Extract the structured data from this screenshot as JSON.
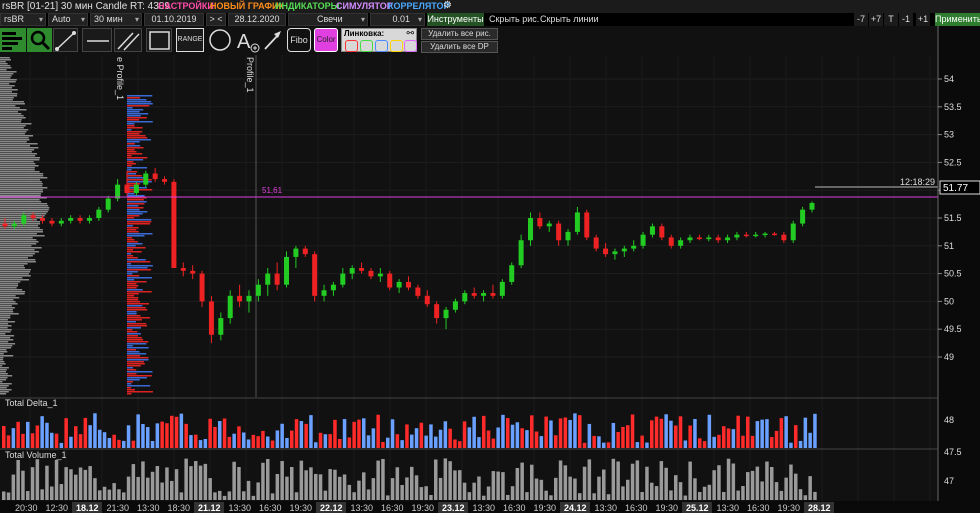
{
  "window": {
    "title": "rsBR [01-21] 30 мин Candle RT: 4309"
  },
  "menu": [
    {
      "label": "НАСТРОЙКИ",
      "color": "#ff4aa8"
    },
    {
      "label": "НОВЫЙ ГРАФИК",
      "color": "#ff8c1a"
    },
    {
      "label": "ИНДИКАТОРЫ",
      "color": "#55dd55"
    },
    {
      "label": "СИМУЛЯТОР",
      "color": "#d48cff"
    },
    {
      "label": "КОРРЕЛЯТОР",
      "color": "#4aa8ff"
    }
  ],
  "controls": {
    "symbol": "rsBR",
    "scale_mode": "Auto",
    "timeframe": "30 мин",
    "date_from": "01.10.2019",
    "nav": "> <",
    "date_to": "28.12.2020",
    "chart_type": "Свечи",
    "step": "0.01",
    "instruments_label": "Инструменты",
    "hide_drawings": "Скрыть рис.",
    "hide_lines": "Скрыть линии",
    "shift_buttons": [
      "-7",
      "+7",
      "T",
      "-1",
      "+1"
    ],
    "apply_label": "Применить"
  },
  "tools": {
    "range_label": "RANGE",
    "fibo_label": "Fibo",
    "color_label": "Color",
    "linking_label": "Линковка:",
    "delete_drawings": "Удалить все рис.",
    "delete_dp": "Удалить все DP",
    "link_colors": [
      "#ff3333",
      "#44dd44",
      "#4a8cff",
      "#ffd700",
      "#e066ff"
    ]
  },
  "chart": {
    "profile_labels": [
      "e Profile_1",
      "Profile_1"
    ],
    "level_line_label": "51,61",
    "current_time": "12:18:29",
    "last_price": "51.77",
    "panels": [
      "Total Delta_1",
      "Total Volume_1"
    ],
    "colors": {
      "up": "#22cc22",
      "down": "#ee2222",
      "level": "#e040e0",
      "delta_pos": "#6aa0ff",
      "delta_neg": "#ff2a2a",
      "volume": "#9a9a9a"
    }
  },
  "price_axis": {
    "ticks": [
      "54",
      "53.5",
      "53",
      "52.5",
      "52",
      "51.5",
      "51",
      "50.5",
      "50",
      "49.5",
      "49"
    ],
    "lower_ticks": [
      "48",
      "47.5",
      "47"
    ]
  },
  "time_axis": {
    "labels": [
      "20:30",
      "12:30",
      "18.12",
      "21:30",
      "13:30",
      "18:30",
      "21.12",
      "13:30",
      "16:30",
      "19:30",
      "22.12",
      "13:30",
      "16:30",
      "19:30",
      "23.12",
      "13:30",
      "16:30",
      "19:30",
      "24.12",
      "13:30",
      "16:30",
      "19:30",
      "25.12",
      "13:30",
      "16:30",
      "19:30",
      "28.12"
    ],
    "date_labels": [
      "18.12",
      "21.12",
      "22.12",
      "23.12",
      "24.12",
      "25.12",
      "28.12"
    ]
  },
  "chart_data": {
    "type": "candlestick",
    "y_range": [
      48.7,
      54.2
    ],
    "level": 51.61,
    "last": 51.77,
    "candles_ohlc": [
      [
        51.4,
        51.5,
        51.3,
        51.35
      ],
      [
        51.35,
        51.45,
        51.3,
        51.4
      ],
      [
        51.4,
        51.6,
        51.35,
        51.55
      ],
      [
        51.55,
        51.6,
        51.45,
        51.5
      ],
      [
        51.5,
        51.55,
        51.4,
        51.45
      ],
      [
        51.45,
        51.5,
        51.35,
        51.4
      ],
      [
        51.4,
        51.5,
        51.35,
        51.45
      ],
      [
        51.45,
        51.55,
        51.4,
        51.5
      ],
      [
        51.5,
        51.55,
        51.4,
        51.45
      ],
      [
        51.45,
        51.55,
        51.4,
        51.5
      ],
      [
        51.5,
        51.7,
        51.45,
        51.65
      ],
      [
        51.65,
        51.9,
        51.6,
        51.85
      ],
      [
        51.85,
        52.2,
        51.8,
        52.1
      ],
      [
        52.1,
        52.35,
        51.9,
        51.95
      ],
      [
        51.95,
        52.15,
        51.9,
        52.1
      ],
      [
        52.1,
        52.35,
        52.05,
        52.3
      ],
      [
        52.3,
        52.4,
        52.15,
        52.2
      ],
      [
        52.2,
        52.25,
        52.1,
        52.15
      ],
      [
        52.15,
        52.2,
        50.6,
        50.6
      ],
      [
        50.6,
        50.7,
        50.45,
        50.55
      ],
      [
        50.55,
        50.65,
        50.4,
        50.5
      ],
      [
        50.5,
        50.55,
        49.9,
        50.0
      ],
      [
        50.0,
        50.1,
        49.25,
        49.4
      ],
      [
        49.4,
        49.8,
        49.3,
        49.7
      ],
      [
        49.7,
        50.2,
        49.6,
        50.1
      ],
      [
        50.1,
        50.3,
        49.9,
        50.0
      ],
      [
        50.0,
        50.2,
        49.8,
        50.1
      ],
      [
        50.1,
        50.4,
        50.0,
        50.3
      ],
      [
        50.3,
        50.6,
        50.1,
        50.5
      ],
      [
        50.5,
        50.7,
        50.2,
        50.3
      ],
      [
        50.3,
        50.9,
        50.25,
        50.8
      ],
      [
        50.8,
        51.0,
        50.6,
        50.95
      ],
      [
        50.95,
        51.0,
        50.8,
        50.85
      ],
      [
        50.85,
        50.9,
        50.0,
        50.1
      ],
      [
        50.1,
        50.3,
        50.0,
        50.2
      ],
      [
        50.2,
        50.35,
        50.1,
        50.3
      ],
      [
        50.3,
        50.6,
        50.25,
        50.5
      ],
      [
        50.5,
        50.65,
        50.4,
        50.6
      ],
      [
        50.6,
        50.7,
        50.5,
        50.55
      ],
      [
        50.55,
        50.6,
        50.4,
        50.45
      ],
      [
        50.45,
        50.6,
        50.35,
        50.5
      ],
      [
        50.5,
        50.55,
        50.2,
        50.25
      ],
      [
        50.25,
        50.4,
        50.15,
        50.35
      ],
      [
        50.35,
        50.45,
        50.2,
        50.25
      ],
      [
        50.25,
        50.3,
        50.05,
        50.1
      ],
      [
        50.1,
        50.2,
        49.9,
        49.95
      ],
      [
        49.95,
        50.0,
        49.6,
        49.7
      ],
      [
        49.7,
        49.9,
        49.5,
        49.85
      ],
      [
        49.85,
        50.05,
        49.8,
        50.0
      ],
      [
        50.0,
        50.2,
        49.95,
        50.15
      ],
      [
        50.15,
        50.25,
        50.05,
        50.1
      ],
      [
        50.1,
        50.2,
        50.0,
        50.15
      ],
      [
        50.15,
        50.3,
        50.05,
        50.1
      ],
      [
        50.1,
        50.4,
        50.05,
        50.35
      ],
      [
        50.35,
        50.7,
        50.3,
        50.65
      ],
      [
        50.65,
        51.2,
        50.6,
        51.1
      ],
      [
        51.1,
        51.6,
        51.0,
        51.5
      ],
      [
        51.5,
        51.6,
        51.3,
        51.35
      ],
      [
        51.35,
        51.45,
        51.25,
        51.4
      ],
      [
        51.4,
        51.45,
        51.0,
        51.1
      ],
      [
        51.1,
        51.3,
        51.0,
        51.25
      ],
      [
        51.25,
        51.7,
        51.2,
        51.6
      ],
      [
        51.6,
        51.65,
        51.1,
        51.15
      ],
      [
        51.15,
        51.2,
        50.9,
        50.95
      ],
      [
        50.95,
        51.05,
        50.8,
        50.85
      ],
      [
        50.85,
        50.95,
        50.75,
        50.9
      ],
      [
        50.9,
        51.0,
        50.8,
        50.95
      ],
      [
        50.95,
        51.1,
        50.9,
        51.0
      ],
      [
        51.0,
        51.25,
        50.95,
        51.2
      ],
      [
        51.2,
        51.4,
        51.15,
        51.35
      ],
      [
        51.35,
        51.4,
        51.1,
        51.15
      ],
      [
        51.15,
        51.2,
        50.95,
        51.0
      ],
      [
        51.0,
        51.15,
        50.95,
        51.1
      ],
      [
        51.1,
        51.2,
        51.05,
        51.15
      ],
      [
        51.15,
        51.2,
        51.1,
        51.12
      ],
      [
        51.12,
        51.2,
        51.08,
        51.15
      ],
      [
        51.15,
        51.2,
        51.05,
        51.1
      ],
      [
        51.1,
        51.2,
        51.05,
        51.15
      ],
      [
        51.15,
        51.25,
        51.1,
        51.2
      ],
      [
        51.2,
        51.25,
        51.15,
        51.18
      ],
      [
        51.18,
        51.25,
        51.15,
        51.2
      ],
      [
        51.2,
        51.25,
        51.15,
        51.22
      ],
      [
        51.22,
        51.25,
        51.18,
        51.2
      ],
      [
        51.2,
        51.25,
        51.05,
        51.1
      ],
      [
        51.1,
        51.45,
        51.05,
        51.4
      ],
      [
        51.4,
        51.7,
        51.35,
        51.65
      ],
      [
        51.65,
        51.8,
        51.6,
        51.77
      ]
    ],
    "delta_panel_ticks": [
      "48",
      "47.5"
    ],
    "volume_panel_ticks": [
      "47"
    ]
  }
}
